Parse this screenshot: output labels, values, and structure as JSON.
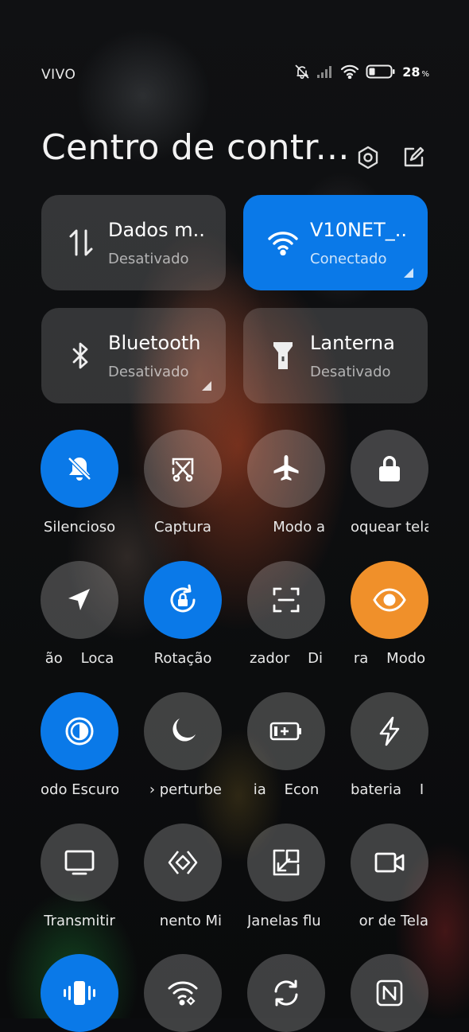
{
  "status_bar": {
    "carrier": "VIVO",
    "battery_percent": "28",
    "battery_unit": "%",
    "battery_level": 0.28,
    "icons": [
      "mute-bell-icon",
      "signal-icon",
      "wifi-icon",
      "battery-icon"
    ]
  },
  "header": {
    "title": "Centro de contr...",
    "icons": [
      "settings-icon",
      "edit-icon"
    ]
  },
  "tiles": [
    {
      "name": "Dados m..",
      "sub": "Desativado",
      "icon": "mobile-data-icon",
      "active": false
    },
    {
      "name": "V10NET_..",
      "sub": "Conectado",
      "icon": "wifi-icon",
      "active": true
    },
    {
      "name": "Bluetooth",
      "sub": "Desativado",
      "icon": "bluetooth-icon",
      "active": false
    },
    {
      "name": "Lanterna",
      "sub": "Desativado",
      "icon": "flashlight-icon",
      "active": false
    }
  ],
  "toggles": [
    {
      "label": "Silencioso",
      "icon": "silent-bell-icon",
      "state": "on"
    },
    {
      "label": "Captura",
      "icon": "screenshot-icon",
      "state": "off"
    },
    {
      "label": "Modo a",
      "icon": "airplane-icon",
      "state": "off"
    },
    {
      "label": "oquear tela",
      "icon": "lock-icon",
      "state": "off"
    },
    {
      "label": "ão    Loca",
      "icon": "location-icon",
      "state": "off"
    },
    {
      "label": "Rotação",
      "icon": "rotation-lock-icon",
      "state": "on"
    },
    {
      "label": "zador    Di",
      "icon": "scanner-icon",
      "state": "off"
    },
    {
      "label": "ra    Modo",
      "icon": "eye-icon",
      "state": "orange"
    },
    {
      "label": "odo Escuro",
      "icon": "dark-mode-icon",
      "state": "on"
    },
    {
      "label": "› perturbe",
      "icon": "moon-icon",
      "state": "off"
    },
    {
      "label": "ia    Econ",
      "icon": "battery-saver-icon",
      "state": "off"
    },
    {
      "label": "bateria    I",
      "icon": "lightning-icon",
      "state": "off"
    },
    {
      "label": "Transmitir",
      "icon": "monitor-icon",
      "state": "off"
    },
    {
      "label": "nento Mi",
      "icon": "mi-share-icon",
      "state": "off"
    },
    {
      "label": "Janelas flu",
      "icon": "floating-window-icon",
      "state": "off"
    },
    {
      "label": "or de Tela",
      "icon": "screen-recorder-icon",
      "state": "off"
    },
    {
      "label": "",
      "icon": "vibrate-icon",
      "state": "on"
    },
    {
      "label": "",
      "icon": "wifi-share-icon",
      "state": "off"
    },
    {
      "label": "",
      "icon": "sync-icon",
      "state": "off"
    },
    {
      "label": "",
      "icon": "nfc-icon",
      "state": "off"
    }
  ]
}
